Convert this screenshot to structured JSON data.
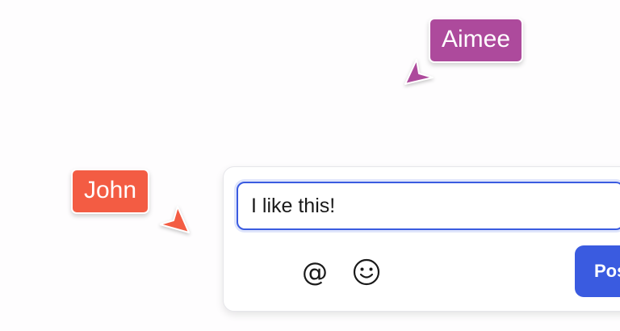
{
  "cursors": {
    "aimee": {
      "name": "Aimee",
      "color": "#ad4a9c"
    },
    "john": {
      "name": "John",
      "color": "#f35c43"
    }
  },
  "composer": {
    "input_value": "I like this!",
    "mention_glyph": "@",
    "mention_icon": "at-sign-icon",
    "emoji_icon": "smiley-face-icon",
    "post_label": "Post",
    "accent_color": "#3a5be0"
  }
}
